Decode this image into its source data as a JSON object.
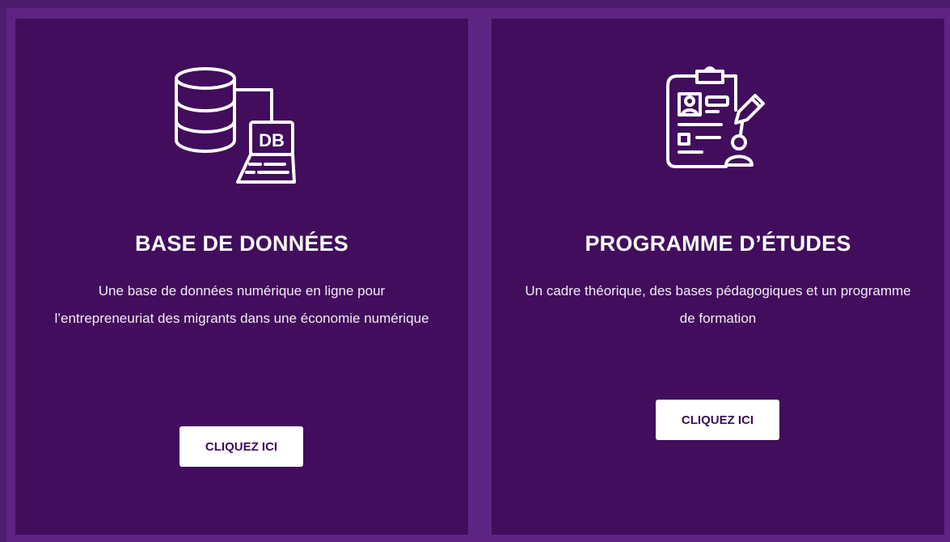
{
  "cards": [
    {
      "icon": "database-icon",
      "title": "BASE DE DONNÉES",
      "description": "Une base de données numérique en ligne pour l’entrepreneuriat des migrants dans une économie numérique",
      "button_label": "CLIQUEZ ICI"
    },
    {
      "icon": "curriculum-clipboard-icon",
      "title": "PROGRAMME D’ÉTUDES",
      "description": "Un cadre théorique, des bases pédagogiques et un programme de formation",
      "button_label": "CLIQUEZ ICI"
    }
  ],
  "icon_text": {
    "db_label": "DB"
  },
  "colors": {
    "page_background": "#5e2483",
    "card_background": "#410d5c",
    "button_background": "#ffffff",
    "button_text": "#3b0f57",
    "text": "#ffffff"
  }
}
